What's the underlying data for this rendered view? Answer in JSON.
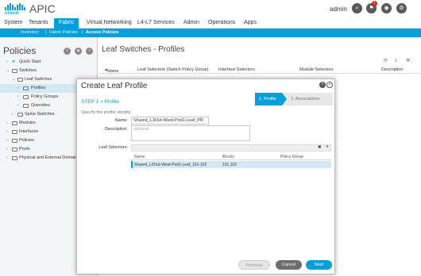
{
  "header": {
    "logo_text": "cisco",
    "app_title": "APIC",
    "user": "admin",
    "notification_count": "1"
  },
  "main_nav": [
    "System",
    "Tenants",
    "Fabric",
    "Virtual Networking",
    "L4-L7 Services",
    "Admin",
    "Operations",
    "Apps"
  ],
  "sub_nav": [
    "Inventory",
    "Fabric Policies",
    "Access Policies"
  ],
  "left_panel": {
    "title": "Policies",
    "tree": [
      "Quick Start",
      "Switches",
      "Leaf Switches",
      "Profiles",
      "Policy Groups",
      "Overrides",
      "Spine Switches",
      "Modules",
      "Interfaces",
      "Policies",
      "Pools",
      "Physical and External Domains"
    ]
  },
  "content": {
    "title": "Leaf Switches - Profiles",
    "columns": [
      "Name",
      "Leaf Selectors (Switch Policy Group)",
      "Interface Selectors",
      "Module Selectors",
      "Description"
    ]
  },
  "modal": {
    "title": "Create Leaf Profile",
    "step_label": "STEP 1 > Profile",
    "step_sub": "Specify the profile identity",
    "wizard_steps": [
      "1. Profile",
      "2. Associations"
    ],
    "name_label": "Name:",
    "name_value": "Shared_L3Out-West-Pod1-Leaf_PR",
    "description_label": "Description:",
    "description_placeholder": "optional",
    "leaf_selectors_label": "Leaf Selectors:",
    "selector_columns": [
      "Name",
      "Blocks",
      "Policy Group"
    ],
    "selector_rows": [
      {
        "name": "Shared_L3Out-West-Pod1-Leaf_101-102",
        "blocks": "101,102",
        "policy_group": ""
      }
    ],
    "buttons": {
      "previous": "Previous",
      "cancel": "Cancel",
      "next": "Next"
    }
  },
  "colors": {
    "accent": "#049fd9",
    "cancel": "#6d6e71",
    "selected_row": "#d4e9f6"
  }
}
